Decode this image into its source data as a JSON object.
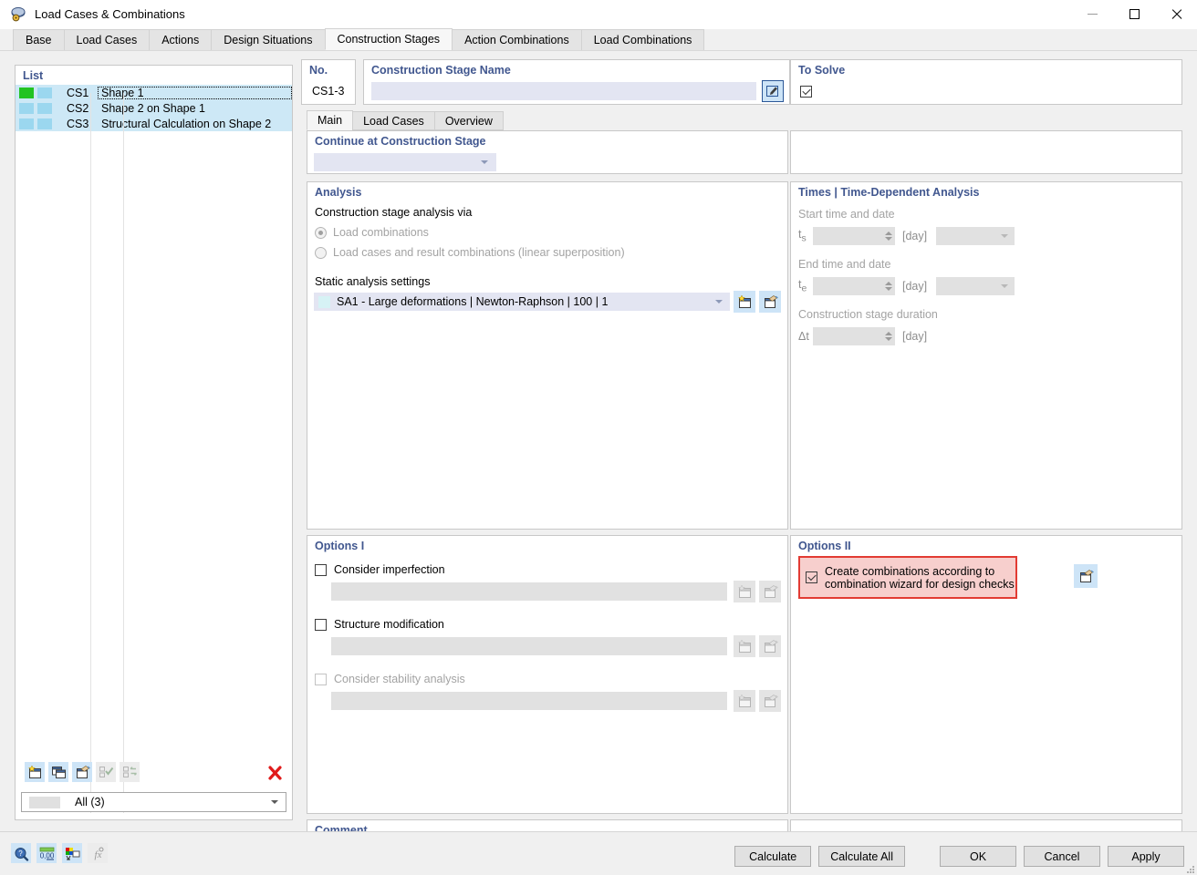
{
  "window": {
    "title": "Load Cases & Combinations",
    "app_icon": "load-cases-icon",
    "minimize": "minimize-icon",
    "maximize": "maximize-icon",
    "close": "close-icon"
  },
  "tabs": [
    {
      "label": "Base",
      "active": false
    },
    {
      "label": "Load Cases",
      "active": false
    },
    {
      "label": "Actions",
      "active": false
    },
    {
      "label": "Design Situations",
      "active": false
    },
    {
      "label": "Construction Stages",
      "active": true
    },
    {
      "label": "Action Combinations",
      "active": false
    },
    {
      "label": "Load Combinations",
      "active": false
    }
  ],
  "list_panel": {
    "caption": "List",
    "rows": [
      {
        "no": "CS1",
        "name": "Shape 1",
        "color": "#22c322",
        "selected": true
      },
      {
        "no": "CS2",
        "name": "Shape 2 on Shape 1",
        "color": "#9bd7ef",
        "selected": false
      },
      {
        "no": "CS3",
        "name": "Structural Calculation on Shape 2",
        "color": "#9bd7ef",
        "selected": false
      }
    ],
    "toolbar": [
      {
        "name": "new-construction-stage-button",
        "icon": "new-window-star-icon",
        "enabled": true
      },
      {
        "name": "copy-construction-stage-button",
        "icon": "copy-windows-icon",
        "enabled": true
      },
      {
        "name": "edit-construction-stage-button",
        "icon": "edit-window-icon",
        "enabled": true
      },
      {
        "name": "select-all-button",
        "icon": "checklist-check-icon",
        "enabled": false
      },
      {
        "name": "invert-selection-button",
        "icon": "checklist-swap-icon",
        "enabled": false
      },
      {
        "name": "delete-construction-stage-button",
        "icon": "red-x-icon",
        "enabled": true
      }
    ],
    "filter_value": "All (3)"
  },
  "header": {
    "no_label": "No.",
    "no_value": "CS1-3",
    "name_label": "Construction Stage Name",
    "name_value": "",
    "name_placeholder": "",
    "edit_icon": "pencil-edit-icon",
    "to_solve_label": "To Solve",
    "to_solve_checked": true
  },
  "inner_tabs": [
    {
      "label": "Main",
      "active": true
    },
    {
      "label": "Load Cases",
      "active": false
    },
    {
      "label": "Overview",
      "active": false
    }
  ],
  "continue_stage": {
    "title": "Continue at Construction Stage",
    "value": "",
    "dropdown_icon": "chevron-down-icon"
  },
  "analysis": {
    "title": "Analysis",
    "subtitle": "Construction stage analysis via",
    "options": [
      {
        "label": "Load combinations",
        "selected": true,
        "disabled": true
      },
      {
        "label": "Load cases and result combinations (linear superposition)",
        "selected": false,
        "disabled": true
      }
    ],
    "settings_label": "Static analysis settings",
    "settings_value": "SA1 - Large deformations | Newton-Raphson | 100 | 1",
    "settings_swatch": "#d6f2f5",
    "dropdown_icon": "chevron-down-icon",
    "new_button_icon": "new-window-star-icon",
    "edit_button_icon": "edit-window-icon"
  },
  "times": {
    "title": "Times | Time-Dependent Analysis",
    "start_label": "Start time and date",
    "start_symbol": "ts",
    "start_value": "",
    "start_unit": "[day]",
    "start_date_value": "",
    "end_label": "End time and date",
    "end_symbol": "te",
    "end_value": "",
    "end_unit": "[day]",
    "end_date_value": "",
    "duration_label": "Construction stage duration",
    "duration_symbol": "Δt",
    "duration_value": "",
    "duration_unit": "[day]"
  },
  "options_i": {
    "title": "Options I",
    "items": [
      {
        "label": "Consider imperfection",
        "checked": false,
        "disabled": false,
        "value": ""
      },
      {
        "label": "Structure modification",
        "checked": false,
        "disabled": false,
        "value": ""
      },
      {
        "label": "Consider stability analysis",
        "checked": false,
        "disabled": true,
        "value": ""
      }
    ],
    "new_button_icon": "new-window-star-icon",
    "edit_button_icon": "edit-window-icon"
  },
  "options_ii": {
    "title": "Options II",
    "checkbox_label_line1": "Create combinations according to",
    "checkbox_label_line2": "combination wizard for design checks",
    "checked": true,
    "highlight_border_color": "#e23b33",
    "highlight_fill_color": "#f7cfcd",
    "wizard_button_icon": "edit-window-icon"
  },
  "comment": {
    "title": "Comment",
    "value": "",
    "dropdown_icon": "chevron-down-icon",
    "copy_button_icon": "copy-windows-icon"
  },
  "status_toolbar": [
    {
      "name": "info-button",
      "icon": "magnifier-question-icon",
      "enabled": true
    },
    {
      "name": "decimal-places-button",
      "icon": "number-format-icon",
      "enabled": true
    },
    {
      "name": "units-button",
      "icon": "units-colors-icon",
      "enabled": true
    },
    {
      "name": "formula-button",
      "icon": "fx-formula-icon",
      "enabled": false
    }
  ],
  "footer_buttons": [
    {
      "label": "Calculate",
      "name": "calculate-button"
    },
    {
      "label": "Calculate All",
      "name": "calculate-all-button"
    },
    {
      "label": "OK",
      "name": "ok-button"
    },
    {
      "label": "Cancel",
      "name": "cancel-button"
    },
    {
      "label": "Apply",
      "name": "apply-button"
    }
  ]
}
